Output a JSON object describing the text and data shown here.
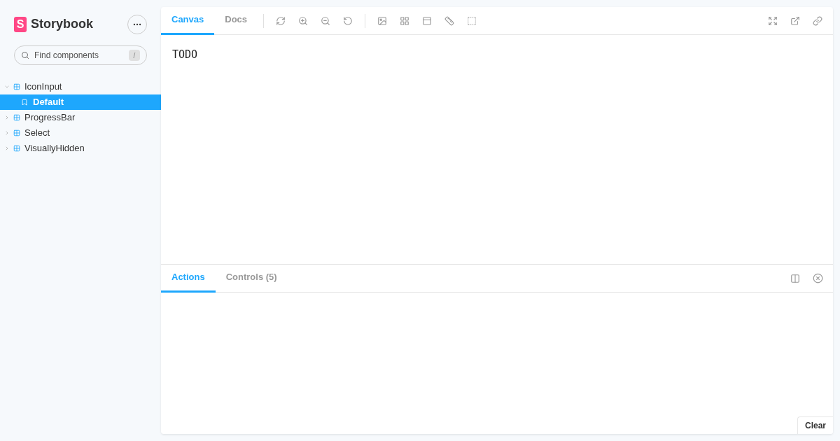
{
  "sidebar": {
    "logo_mark": "S",
    "brand": "Storybook",
    "search": {
      "placeholder": "Find components",
      "shortcut": "/"
    },
    "tree": [
      {
        "label": "IconInput",
        "expanded": true,
        "selected": false,
        "children": [
          {
            "label": "Default",
            "selected": true
          }
        ]
      },
      {
        "label": "ProgressBar",
        "expanded": false,
        "selected": false
      },
      {
        "label": "Select",
        "expanded": false,
        "selected": false
      },
      {
        "label": "VisuallyHidden",
        "expanded": false,
        "selected": false
      }
    ]
  },
  "toolbar": {
    "tabs": [
      {
        "label": "Canvas",
        "selected": true
      },
      {
        "label": "Docs",
        "selected": false
      }
    ]
  },
  "canvas": {
    "text": "TODO"
  },
  "addons": {
    "tabs": [
      {
        "label": "Actions",
        "selected": true
      },
      {
        "label": "Controls (5)",
        "selected": false
      }
    ],
    "clear_button": "Clear"
  }
}
